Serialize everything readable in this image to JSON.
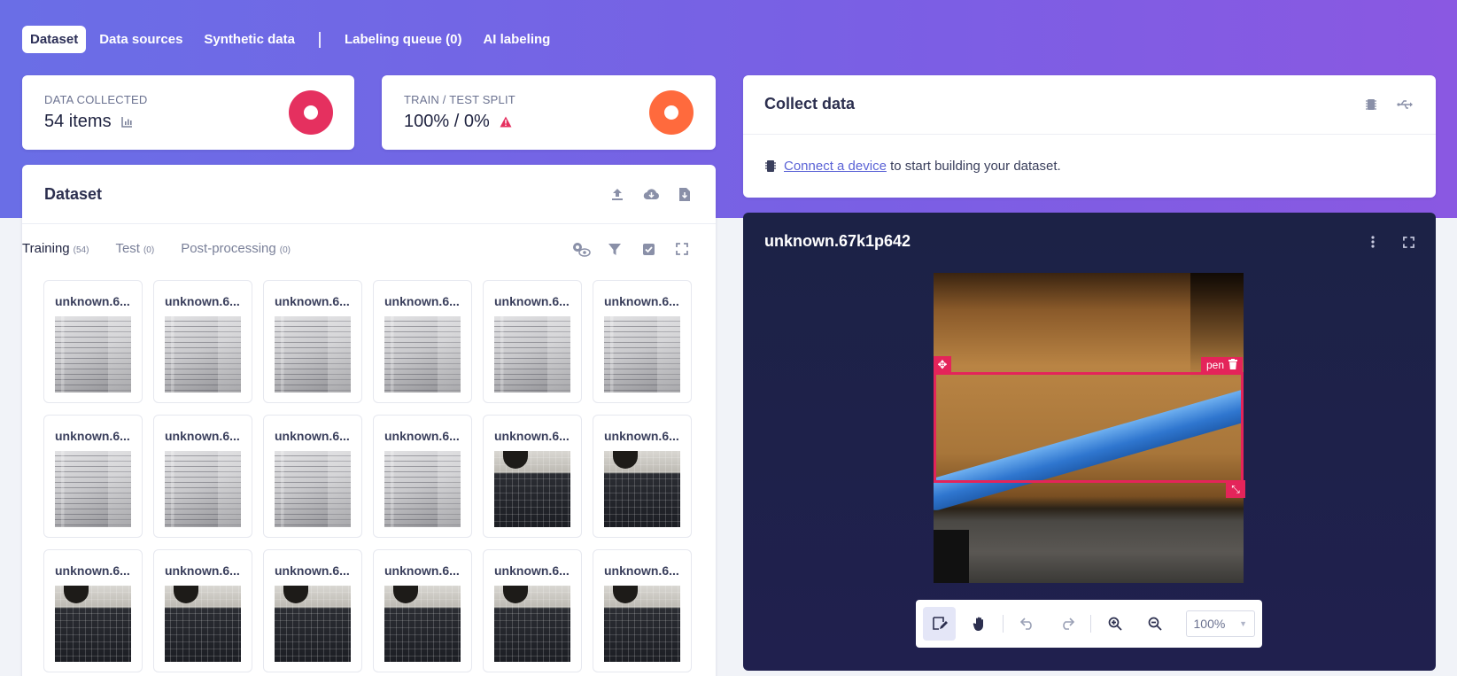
{
  "nav": {
    "items": [
      {
        "label": "Dataset",
        "active": true
      },
      {
        "label": "Data sources",
        "active": false
      },
      {
        "label": "Synthetic data",
        "active": false
      },
      {
        "label": "Labeling queue (0)",
        "active": false
      },
      {
        "label": "AI labeling",
        "active": false
      }
    ]
  },
  "stats": {
    "collected": {
      "label": "DATA COLLECTED",
      "value": "54 items",
      "color": "#e5305f"
    },
    "split": {
      "label": "TRAIN / TEST SPLIT",
      "value": "100% / 0%",
      "color": "#ff6a3d"
    }
  },
  "dataset_panel": {
    "title": "Dataset",
    "tabs": [
      {
        "label": "Training",
        "count": "(54)",
        "active": true
      },
      {
        "label": "Test",
        "count": "(0)",
        "active": false
      },
      {
        "label": "Post-processing",
        "count": "(0)",
        "active": false
      }
    ],
    "items": [
      {
        "name": "unknown.6...",
        "kind": "doc"
      },
      {
        "name": "unknown.6...",
        "kind": "doc"
      },
      {
        "name": "unknown.6...",
        "kind": "doc"
      },
      {
        "name": "unknown.6...",
        "kind": "doc"
      },
      {
        "name": "unknown.6...",
        "kind": "doc"
      },
      {
        "name": "unknown.6...",
        "kind": "doc"
      },
      {
        "name": "unknown.6...",
        "kind": "doc"
      },
      {
        "name": "unknown.6...",
        "kind": "doc"
      },
      {
        "name": "unknown.6...",
        "kind": "doc"
      },
      {
        "name": "unknown.6...",
        "kind": "doc"
      },
      {
        "name": "unknown.6...",
        "kind": "kb"
      },
      {
        "name": "unknown.6...",
        "kind": "kb"
      },
      {
        "name": "unknown.6...",
        "kind": "kb"
      },
      {
        "name": "unknown.6...",
        "kind": "kb"
      },
      {
        "name": "unknown.6...",
        "kind": "kb"
      },
      {
        "name": "unknown.6...",
        "kind": "kb"
      },
      {
        "name": "unknown.6...",
        "kind": "kb"
      },
      {
        "name": "unknown.6...",
        "kind": "kb"
      }
    ]
  },
  "collect": {
    "title": "Collect data",
    "link_text": "Connect a device",
    "rest_text": " to start building your dataset."
  },
  "viewer": {
    "title": "unknown.67k1p642",
    "bbox_label": "pen",
    "zoom": "100%"
  }
}
